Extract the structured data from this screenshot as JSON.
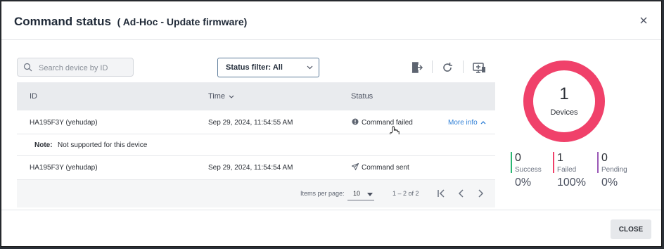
{
  "dialog": {
    "title": "Command status",
    "subtitle": "( Ad-Hoc - Update firmware)"
  },
  "toolbar": {
    "search_placeholder": "Search device by ID",
    "status_filter_label": "Status filter: All",
    "icons": [
      "export-icon",
      "refresh-icon",
      "device-add-icon"
    ]
  },
  "table": {
    "columns": [
      "ID",
      "Time",
      "Status"
    ],
    "rows": [
      {
        "id": "HA195F3Y (yehudap)",
        "time": "Sep 29, 2024, 11:54:55 AM",
        "status": "Command failed",
        "status_icon": "alert-circle-icon",
        "action": "More info",
        "expanded": true
      },
      {
        "id": "HA195F3Y (yehudap)",
        "time": "Sep 29, 2024, 11:54:54 AM",
        "status": "Command sent",
        "status_icon": "send-icon"
      }
    ],
    "note_label": "Note:",
    "note_text": "Not supported for this device"
  },
  "paginator": {
    "items_per_page_label": "Items per page:",
    "items_per_page": "10",
    "range": "1 – 2 of 2"
  },
  "summary": {
    "total": "1",
    "total_label": "Devices",
    "ring_color": "#f0416a",
    "success_fraction": 0,
    "failed_fraction": 1,
    "pending_fraction": 0,
    "stats": [
      {
        "count": "0",
        "label": "Success",
        "percent": "0%",
        "color": "#2bb673"
      },
      {
        "count": "1",
        "label": "Failed",
        "percent": "100%",
        "color": "#f0416a"
      },
      {
        "count": "0",
        "label": "Pending",
        "percent": "0%",
        "color": "#9b59b6"
      }
    ]
  },
  "footer": {
    "close_label": "CLOSE"
  }
}
